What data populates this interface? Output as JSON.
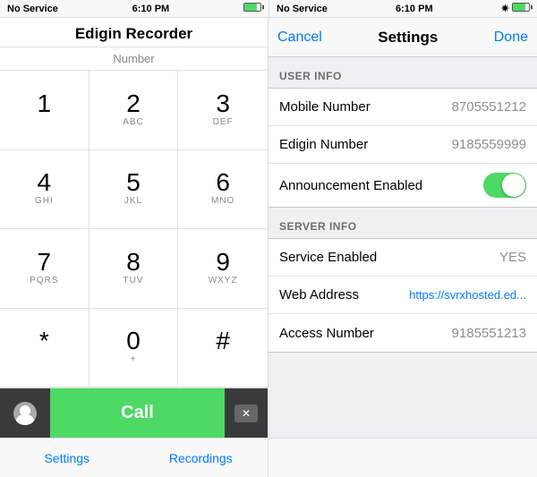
{
  "left": {
    "status": {
      "signal": "No Service",
      "time": "6:10 PM",
      "bluetooth": true,
      "battery": 80
    },
    "title": "Edigin Recorder",
    "number_label": "Number",
    "keys": [
      {
        "num": "1",
        "letters": ""
      },
      {
        "num": "2",
        "letters": "ABC"
      },
      {
        "num": "3",
        "letters": "DEF"
      },
      {
        "num": "4",
        "letters": "GHI"
      },
      {
        "num": "5",
        "letters": "JKL"
      },
      {
        "num": "6",
        "letters": "MNO"
      },
      {
        "num": "7",
        "letters": "PQRS"
      },
      {
        "num": "8",
        "letters": "TUV"
      },
      {
        "num": "9",
        "letters": "WXYZ"
      },
      {
        "num": "*",
        "letters": ""
      },
      {
        "num": "0",
        "letters": "+"
      },
      {
        "num": "#",
        "letters": ""
      }
    ],
    "call_label": "Call",
    "tabs": [
      {
        "label": "Settings"
      },
      {
        "label": "Recordings"
      }
    ]
  },
  "right": {
    "status": {
      "signal": "No Service",
      "time": "6:10 PM",
      "bluetooth": true,
      "battery": 80
    },
    "cancel_label": "Cancel",
    "title": "Settings",
    "done_label": "Done",
    "sections": [
      {
        "header": "USER INFO",
        "rows": [
          {
            "label": "Mobile Number",
            "value": "8705551212",
            "type": "text"
          },
          {
            "label": "Edigin Number",
            "value": "9185559999",
            "type": "text"
          },
          {
            "label": "Announcement Enabled",
            "value": "",
            "type": "toggle",
            "on": true
          }
        ]
      },
      {
        "header": "SERVER INFO",
        "rows": [
          {
            "label": "Service Enabled",
            "value": "YES",
            "type": "text"
          },
          {
            "label": "Web Address",
            "value": "https://svrxhosted.ed...",
            "type": "link"
          },
          {
            "label": "Access Number",
            "value": "9185551213",
            "type": "text"
          }
        ]
      }
    ]
  }
}
